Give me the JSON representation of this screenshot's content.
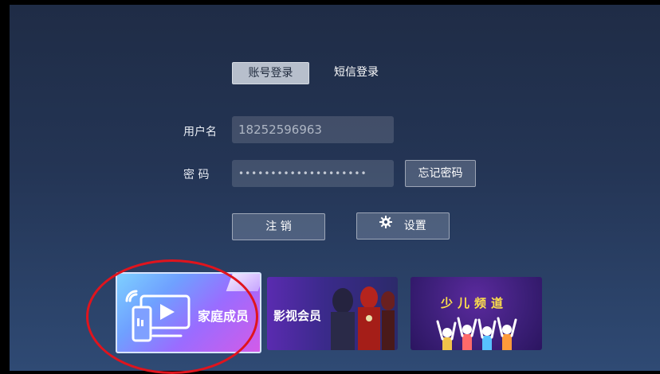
{
  "tabs": [
    {
      "label": "账号登录",
      "active": true
    },
    {
      "label": "短信登录",
      "active": false
    }
  ],
  "form": {
    "username_label": "用户名",
    "username_value": "18252596963",
    "password_label": "密 码",
    "password_mask": "••••••••••••••••••••",
    "forgot_label": "忘记密码"
  },
  "actions": {
    "logout_label": "注 销",
    "settings_label": "设置"
  },
  "cards": [
    {
      "title": "家庭成员"
    },
    {
      "title": "影视会员"
    },
    {
      "title": "少儿频道"
    }
  ],
  "colors": {
    "highlight_circle": "#e0141d"
  }
}
